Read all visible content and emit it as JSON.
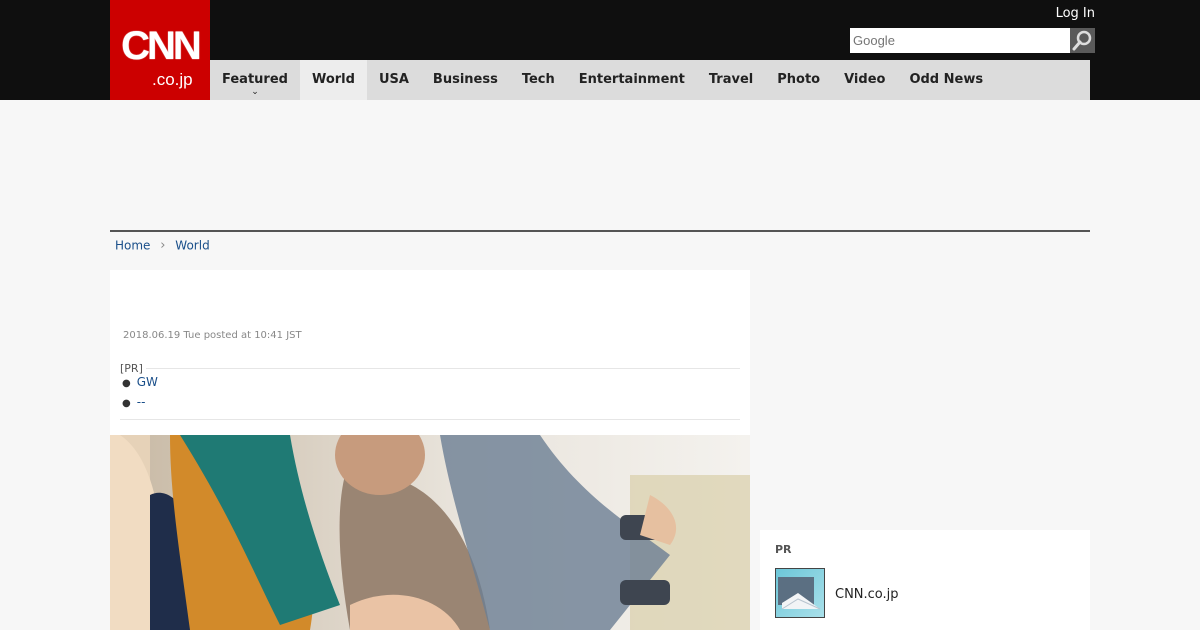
{
  "header": {
    "logo_main": "CNN",
    "logo_sub": ".co.jp",
    "login_label": "Log In",
    "search": {
      "placeholder": "Google",
      "icon": "search-icon"
    }
  },
  "nav": {
    "items": [
      {
        "label": "Featured",
        "has_dropdown": true
      },
      {
        "label": "World"
      },
      {
        "label": "USA"
      },
      {
        "label": "Business"
      },
      {
        "label": "Tech"
      },
      {
        "label": "Entertainment"
      },
      {
        "label": "Travel"
      },
      {
        "label": "Photo"
      },
      {
        "label": "Video"
      },
      {
        "label": "Odd News"
      }
    ]
  },
  "breadcrumb": {
    "home": "Home",
    "current": "World"
  },
  "article": {
    "timestamp": "2018.06.19 Tue posted at 10:41 JST",
    "pr_label": "[PR]",
    "pr_links": [
      "GW",
      "--"
    ]
  },
  "sidebar": {
    "pr_title": "PR",
    "pr_item_name": "CNN.co.jp"
  },
  "colors": {
    "logo_red": "#cc0000",
    "topbar": "#0f0f0f",
    "nav_bg": "#dcdcdc",
    "link": "#1a4f8a"
  }
}
